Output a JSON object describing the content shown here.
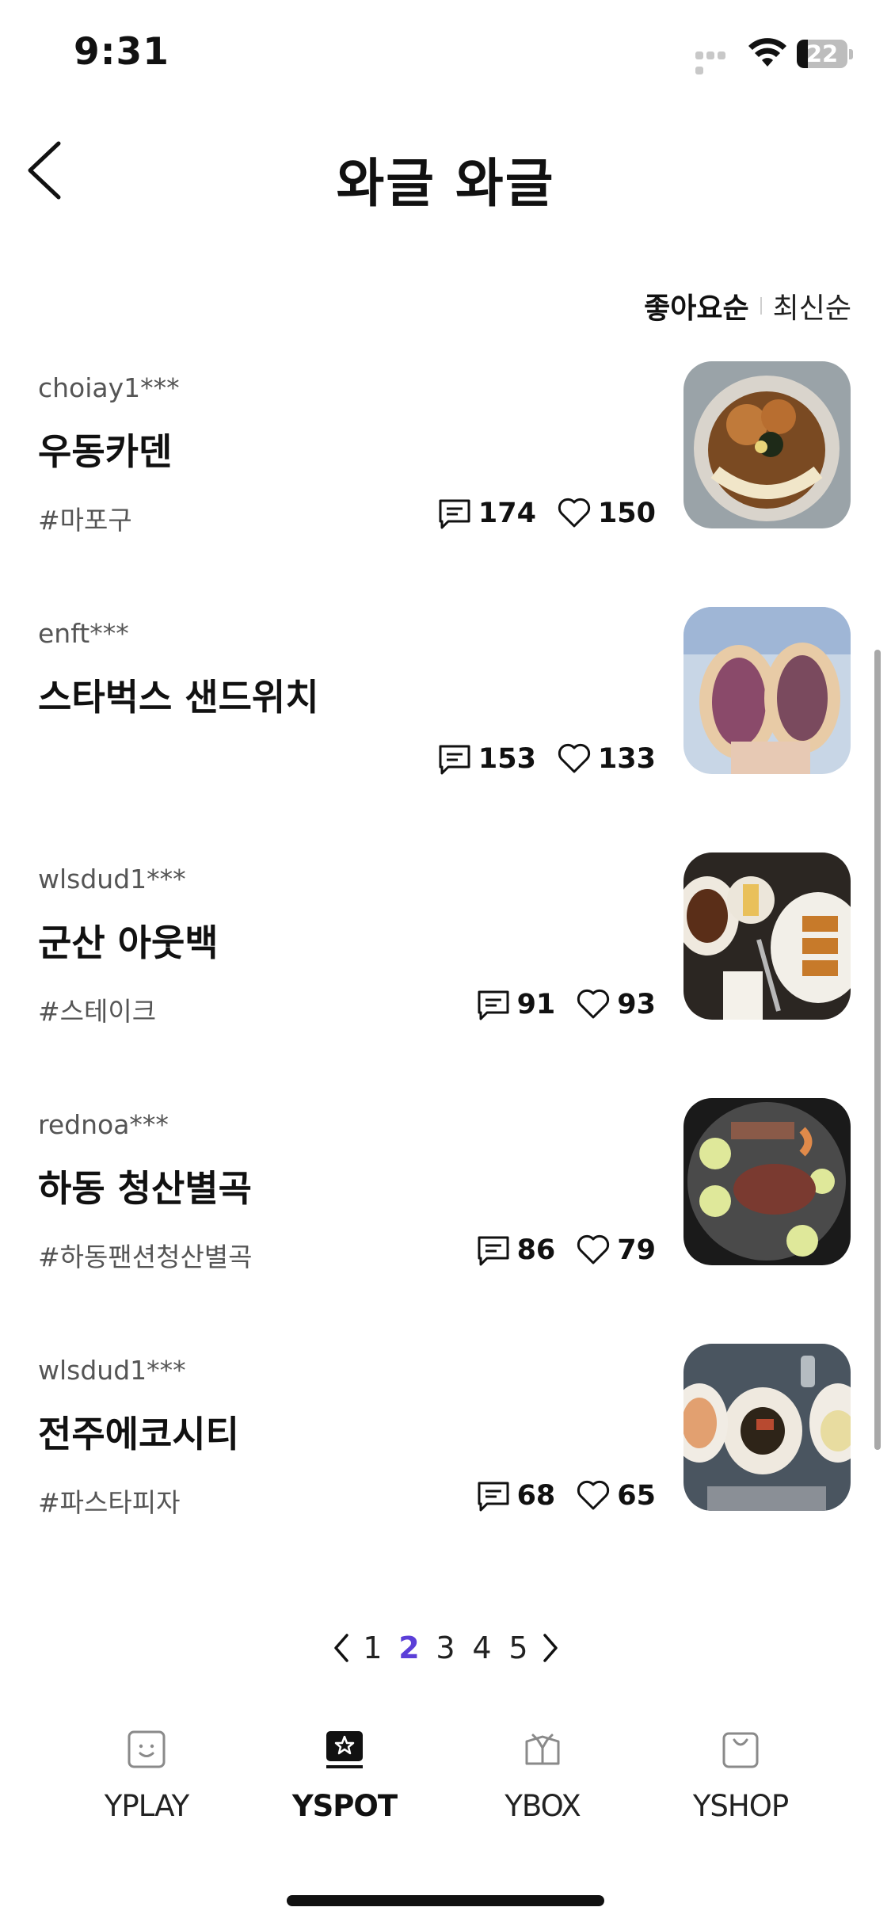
{
  "status": {
    "time": "9:31",
    "battery": "22",
    "battery_level": 0.22
  },
  "header": {
    "title": "와글 와글",
    "back_icon": "chevron-left-icon"
  },
  "sort": {
    "options": [
      "좋아요순",
      "최신순"
    ],
    "active": "좋아요순"
  },
  "posts": [
    {
      "author": "choiay1***",
      "title": "우동카덴",
      "tag": "#마포구",
      "comments": "174",
      "likes": "150",
      "thumb": "udon-photo"
    },
    {
      "author": "enft***",
      "title": "스타벅스 샌드위치",
      "tag": "",
      "comments": "153",
      "likes": "133",
      "thumb": "sandwich-photo"
    },
    {
      "author": "wlsdud1***",
      "title": "군산 아웃백",
      "tag": "#스테이크",
      "comments": "91",
      "likes": "93",
      "thumb": "steak-dinner-photo"
    },
    {
      "author": "rednoa***",
      "title": "하동 청산별곡",
      "tag": "#하동팬션청산별곡",
      "comments": "86",
      "likes": "79",
      "thumb": "bbq-grill-photo"
    },
    {
      "author": "wlsdud1***",
      "title": "전주에코시티",
      "tag": "#파스타피자",
      "comments": "68",
      "likes": "65",
      "thumb": "pasta-pizza-photo"
    }
  ],
  "pagination": {
    "pages": [
      "1",
      "2",
      "3",
      "4",
      "5"
    ],
    "current": "2"
  },
  "tabs": [
    {
      "label": "YPLAY",
      "icon": "smile-icon",
      "selected": false
    },
    {
      "label": "YSPOT",
      "icon": "star-box-icon",
      "selected": true
    },
    {
      "label": "YBOX",
      "icon": "gift-box-icon",
      "selected": false
    },
    {
      "label": "YSHOP",
      "icon": "shopping-bag-icon",
      "selected": false
    }
  ],
  "colors": {
    "accent": "#5b3fd8",
    "text": "#111111",
    "muted": "#555555"
  }
}
